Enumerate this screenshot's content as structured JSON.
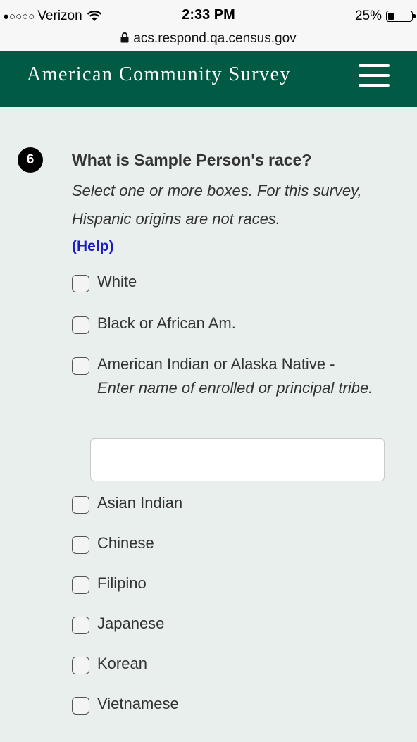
{
  "status_bar": {
    "signal": "●○○○○",
    "carrier": "Verizon",
    "time": "2:33 PM",
    "battery_percent": "25%",
    "battery_level": 0.25,
    "url": "acs.respond.qa.census.gov"
  },
  "header": {
    "title": "American Community Survey",
    "menu_icon": "hamburger-menu-icon",
    "background": "#005a44"
  },
  "question": {
    "number": "6",
    "title": "What is Sample Person's race?",
    "instruction": "Select one or more boxes. For this survey, Hispanic origins are not races.",
    "help_label": "(Help)",
    "options": [
      {
        "label": "White"
      },
      {
        "label": "Black or African Am."
      },
      {
        "label": "American Indian or Alaska Native -",
        "sub": "Enter name of enrolled or principal tribe."
      },
      {
        "label": "Asian Indian"
      },
      {
        "label": "Chinese"
      },
      {
        "label": "Filipino"
      },
      {
        "label": "Japanese"
      },
      {
        "label": "Korean"
      },
      {
        "label": "Vietnamese"
      }
    ],
    "tribe_input": {
      "value": "",
      "placeholder": ""
    }
  },
  "colors": {
    "accent": "#005a44",
    "link": "#1a1ac8",
    "page_background": "#e9efed"
  }
}
